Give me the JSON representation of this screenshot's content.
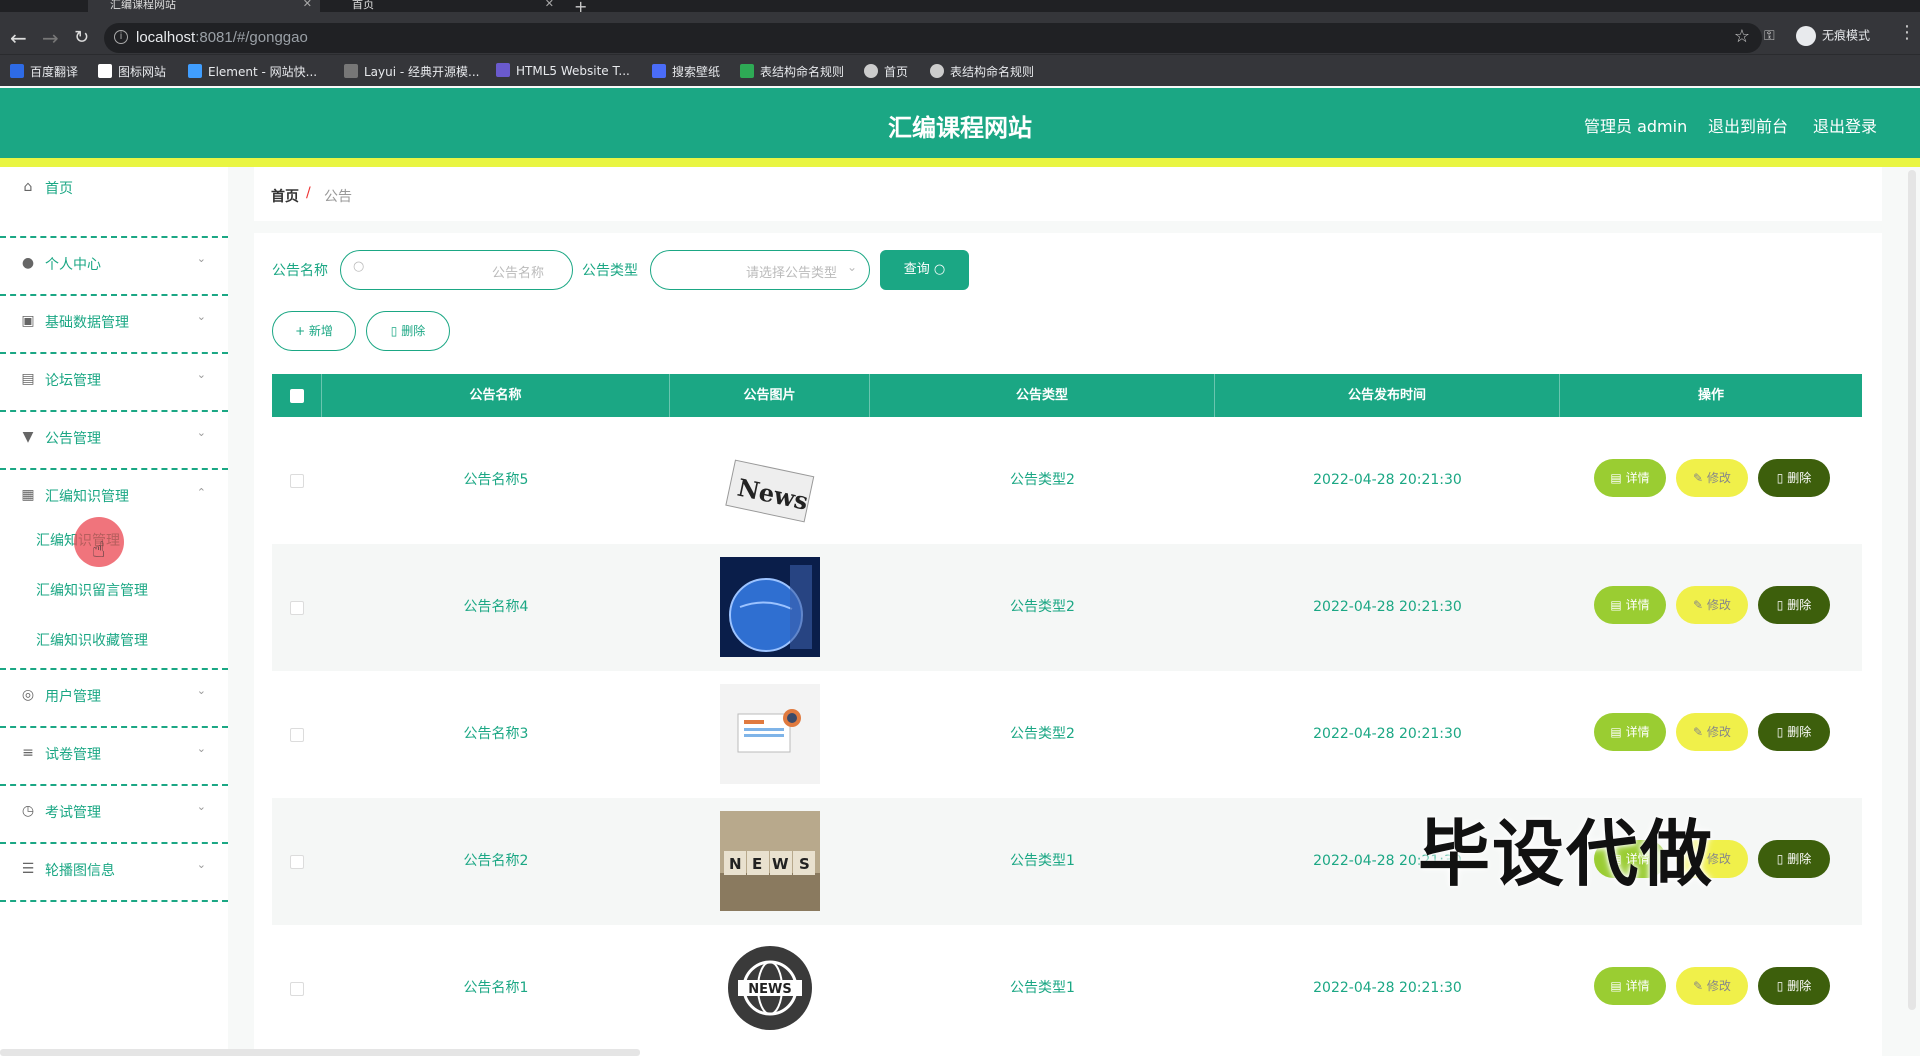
{
  "browser": {
    "tabs": [
      {
        "label": "汇编课程网站",
        "active": true
      },
      {
        "label": "首页",
        "active": false
      }
    ],
    "url_host": "localhost",
    "url_rest": ":8081/#/gonggao",
    "profile": "无痕模式",
    "bookmarks": [
      "百度翻译",
      "图标网站",
      "Element - 网站快...",
      "Layui - 经典开源模...",
      "HTML5 Website T...",
      "搜索壁纸",
      "表结构命名规则",
      "首页",
      "表结构命名规则"
    ]
  },
  "header": {
    "title": "汇编课程网站",
    "admin": "管理员 admin",
    "to_front": "退出到前台",
    "logout": "退出登录"
  },
  "sidebar": {
    "items": [
      {
        "label": "首页",
        "icon": "home-icon"
      },
      {
        "label": "个人中心",
        "icon": "user-icon"
      },
      {
        "label": "基础数据管理",
        "icon": "database-icon"
      },
      {
        "label": "论坛管理",
        "icon": "clipboard-icon"
      },
      {
        "label": "公告管理",
        "icon": "megaphone-icon"
      },
      {
        "label": "汇编知识管理",
        "icon": "briefcase-icon"
      },
      {
        "label": "用户管理",
        "icon": "globe-icon"
      },
      {
        "label": "试卷管理",
        "icon": "list-icon"
      },
      {
        "label": "考试管理",
        "icon": "clock-icon"
      },
      {
        "label": "轮播图信息",
        "icon": "sliders-icon"
      }
    ],
    "subitems": [
      "汇编知识管理",
      "汇编知识留言管理",
      "汇编知识收藏管理"
    ]
  },
  "breadcrumb": {
    "home": "首页",
    "sep": "/",
    "current": "公告"
  },
  "search": {
    "name_label": "公告名称",
    "name_placeholder": "公告名称",
    "type_label": "公告类型",
    "type_placeholder": "请选择公告类型",
    "query": "查询"
  },
  "ops": {
    "add": "+ 新增",
    "delete": "删除"
  },
  "table": {
    "headers": [
      "公告名称",
      "公告图片",
      "公告类型",
      "公告发布时间",
      "操作"
    ],
    "rows": [
      {
        "name": "公告名称5",
        "type": "公告类型2",
        "time": "2022-04-28 20:21:30",
        "image": "news-paper-icon"
      },
      {
        "name": "公告名称4",
        "type": "公告类型2",
        "time": "2022-04-28 20:21:30",
        "image": "globe-news-icon"
      },
      {
        "name": "公告名称3",
        "type": "公告类型2",
        "time": "2022-04-28 20:21:30",
        "image": "newspaper-illustration-icon"
      },
      {
        "name": "公告名称2",
        "type": "公告类型1",
        "time": "2022-04-28 20:21:30",
        "image": "news-blocks-icon"
      },
      {
        "name": "公告名称1",
        "type": "公告类型1",
        "time": "2022-04-28 20:21:30",
        "image": "news-globe-badge-icon"
      }
    ],
    "actions": {
      "detail": "详情",
      "edit": "修改",
      "delete": "删除"
    }
  },
  "watermark": "毕设代做",
  "colors": {
    "primary": "#1ba784",
    "accent_stripe": "#e9f542",
    "detail": "#9acd32",
    "edit": "#f0f04a",
    "delete": "#3d5f0c"
  }
}
